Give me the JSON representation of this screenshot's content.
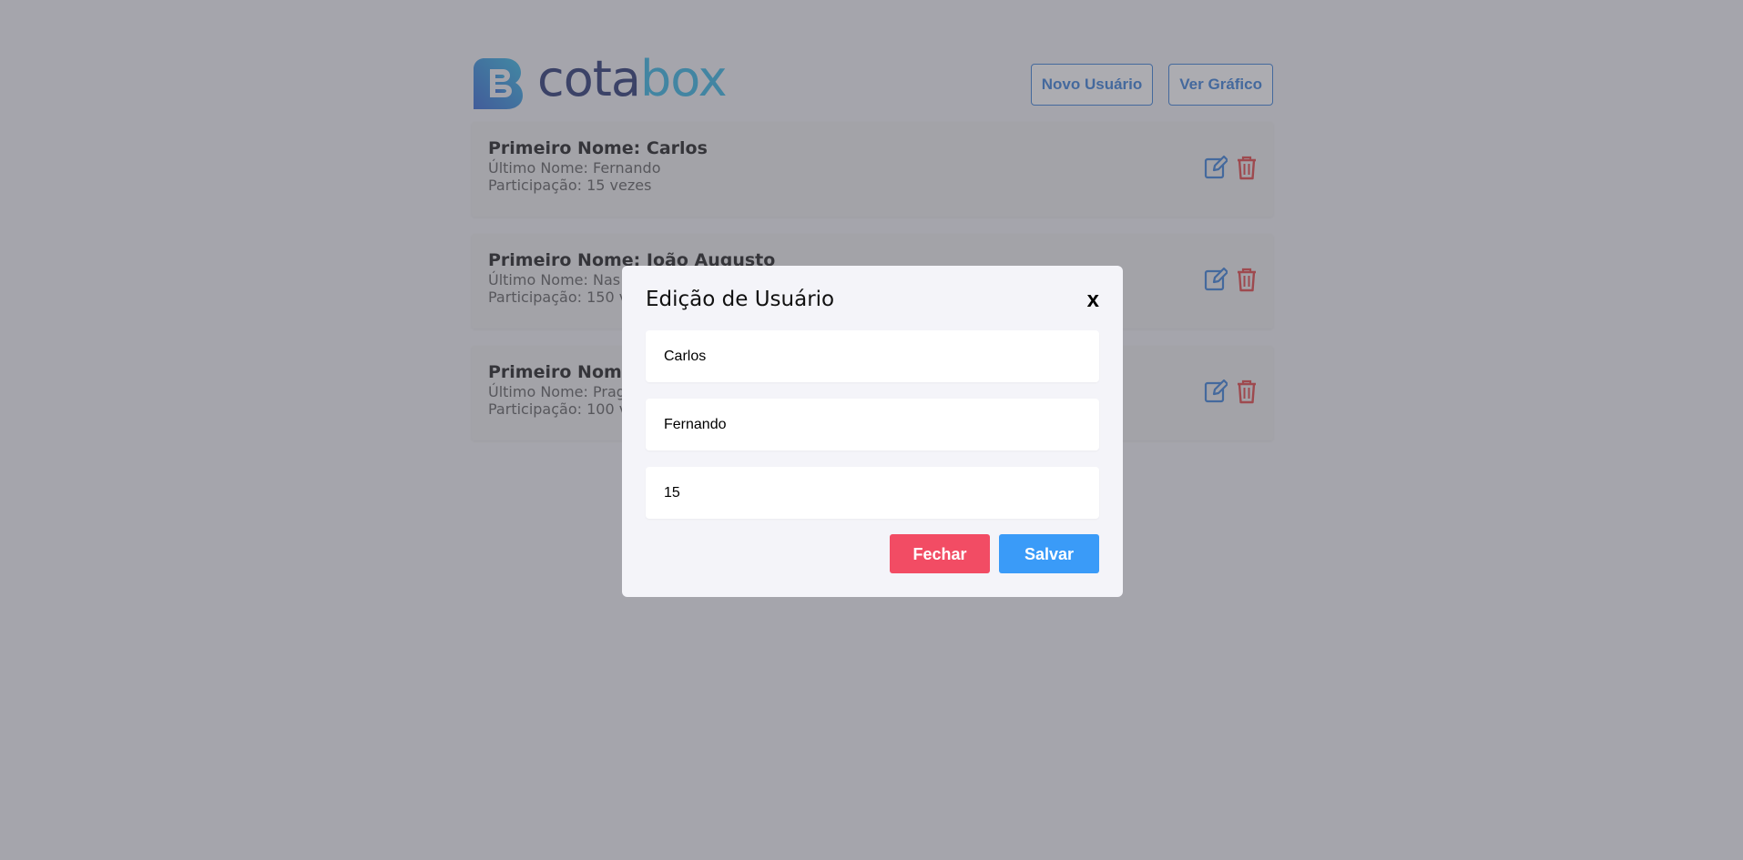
{
  "header": {
    "logo": {
      "part1": "cota",
      "part2": "box"
    },
    "new_user_label": "Novo Usuário",
    "view_chart_label": "Ver Gráfico"
  },
  "users": [
    {
      "first": "Primeiro Nome: Carlos",
      "last": "Último Nome: Fernando",
      "participation": "Participação: 15 vezes"
    },
    {
      "first": "Primeiro Nome: João Augusto",
      "last": "Último Nome: Nas",
      "participation": "Participação: 150 v"
    },
    {
      "first": "Primeiro Nome",
      "last": "Último Nome: Prag",
      "participation": "Participação: 100 v"
    }
  ],
  "modal": {
    "title": "Edição de Usuário",
    "close_label": "x",
    "fields": {
      "first_name": "Carlos",
      "last_name": "Fernando",
      "participation": "15"
    },
    "close_button": "Fechar",
    "save_button": "Salvar"
  },
  "colors": {
    "brand_dark": "#1d2a6b",
    "brand_light": "#2ab0e0",
    "edit_icon": "#2f78d6",
    "delete_icon": "#e23b3b",
    "danger": "#f24c64",
    "primary": "#3a9bf8"
  },
  "icons": {
    "edit": "edit-icon",
    "delete": "trash-icon",
    "logo": "logo-icon"
  }
}
